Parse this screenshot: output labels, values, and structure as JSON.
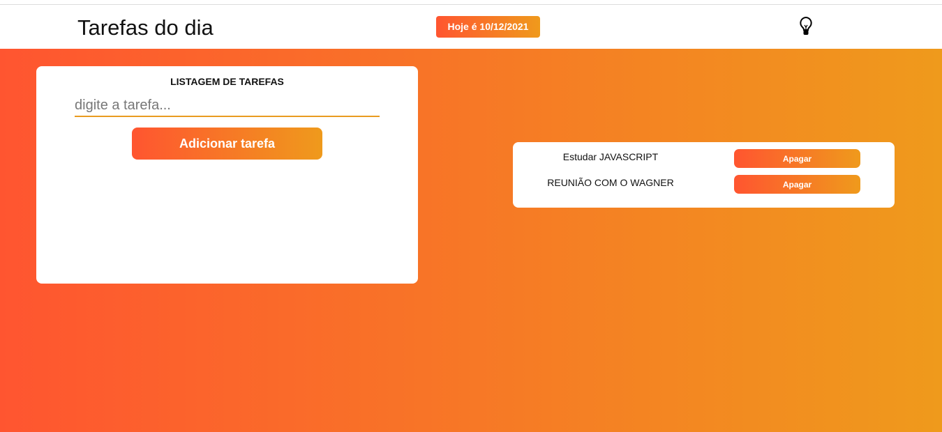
{
  "header": {
    "title": "Tarefas do dia",
    "date_badge": "Hoje é 10/12/2021",
    "theme_icon": "lightbulb-icon"
  },
  "form": {
    "heading": "LISTAGEM DE TAREFAS",
    "input_placeholder": "digite a tarefa...",
    "input_value": "",
    "add_label": "Adicionar tarefa"
  },
  "tasks": [
    {
      "label": "Estudar JAVASCRIPT",
      "delete_label": "Apagar"
    },
    {
      "label": "REUNIÃO COM O WAGNER",
      "delete_label": "Apagar"
    }
  ],
  "colors": {
    "gradient_start": "#ff5530",
    "gradient_end": "#ef9a1c"
  }
}
